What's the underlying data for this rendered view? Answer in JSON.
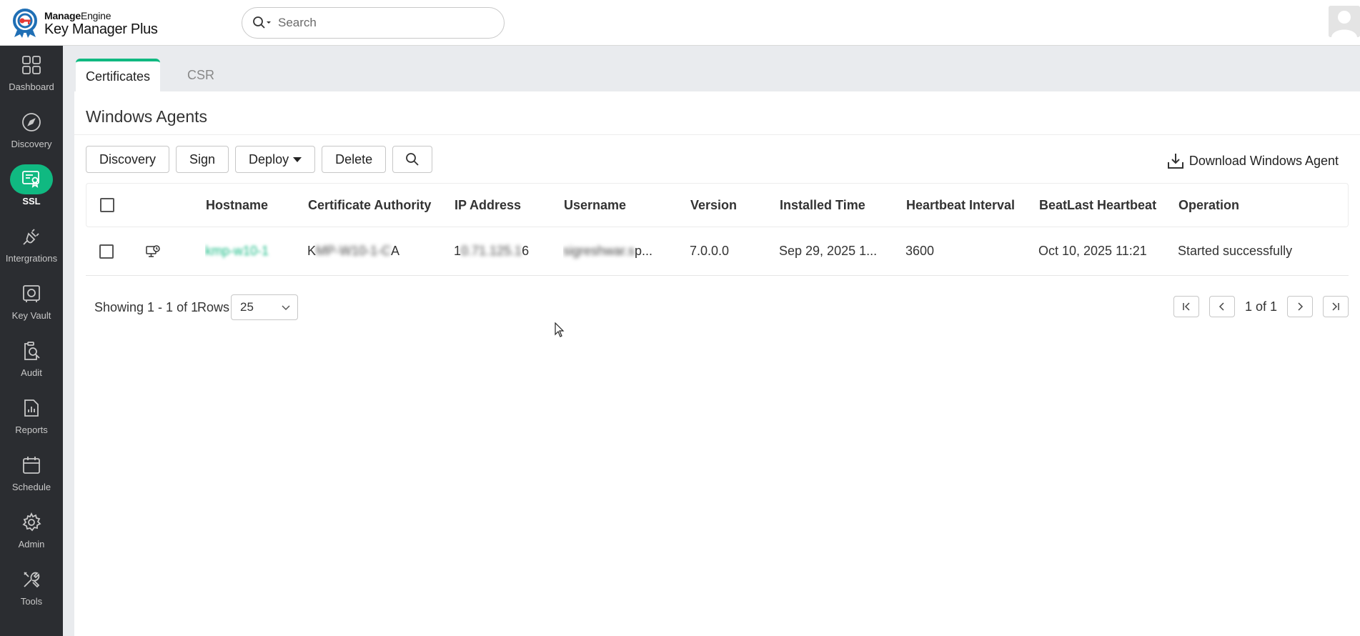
{
  "app": {
    "brand": "ManageEngine",
    "brand_bold": "Manage",
    "brand_light": "Engine",
    "product": "Key Manager Plus"
  },
  "search": {
    "placeholder": "Search"
  },
  "sidebar": {
    "items": [
      {
        "label": "Dashboard",
        "icon": "dashboard-icon"
      },
      {
        "label": "Discovery",
        "icon": "compass-icon"
      },
      {
        "label": "SSL",
        "icon": "certificate-icon",
        "active": true
      },
      {
        "label": "Intergrations",
        "icon": "plug-icon"
      },
      {
        "label": "Key Vault",
        "icon": "vault-icon"
      },
      {
        "label": "Audit",
        "icon": "audit-icon"
      },
      {
        "label": "Reports",
        "icon": "reports-icon"
      },
      {
        "label": "Schedule",
        "icon": "calendar-icon"
      },
      {
        "label": "Admin",
        "icon": "gear-icon"
      },
      {
        "label": "Tools",
        "icon": "tools-icon"
      }
    ]
  },
  "tabs": [
    {
      "label": "Certificates",
      "active": true
    },
    {
      "label": "CSR",
      "active": false
    }
  ],
  "panel": {
    "title": "Windows Agents",
    "toolbar": {
      "discovery": "Discovery",
      "sign": "Sign",
      "deploy": "Deploy",
      "delete": "Delete"
    },
    "download_label": "Download Windows Agent"
  },
  "table": {
    "columns": [
      "Hostname",
      "Certificate Authority",
      "IP Address",
      "Username",
      "Version",
      "Installed Time",
      "Heartbeat Interval",
      "BeatLast Heartbeat",
      "Operation"
    ],
    "rows": [
      {
        "hostname": "kmp-w10-1",
        "ca_visible_start": "K",
        "ca_blurred": "MP-W10-1-C",
        "ca_visible_end": "A",
        "ip_visible_start": "1",
        "ip_blurred": "0.71.125.1",
        "ip_visible_end": "6",
        "username_blurred": "sigreshwar.s",
        "username_visible": "p...",
        "version": "7.0.0.0",
        "installed_time": "Sep 29, 2025 1...",
        "heartbeat_interval": "3600",
        "last_heartbeat": "Oct 10, 2025 11:21",
        "operation": "Started successfully"
      }
    ]
  },
  "footer": {
    "showing": "Showing 1 - 1 of 1",
    "rows_label": "Rows",
    "rows_value": "25",
    "page_text": "1 of 1"
  },
  "colors": {
    "accent": "#10b981",
    "sidebar": "#2b2d31",
    "content_bg": "#e9ebee"
  }
}
